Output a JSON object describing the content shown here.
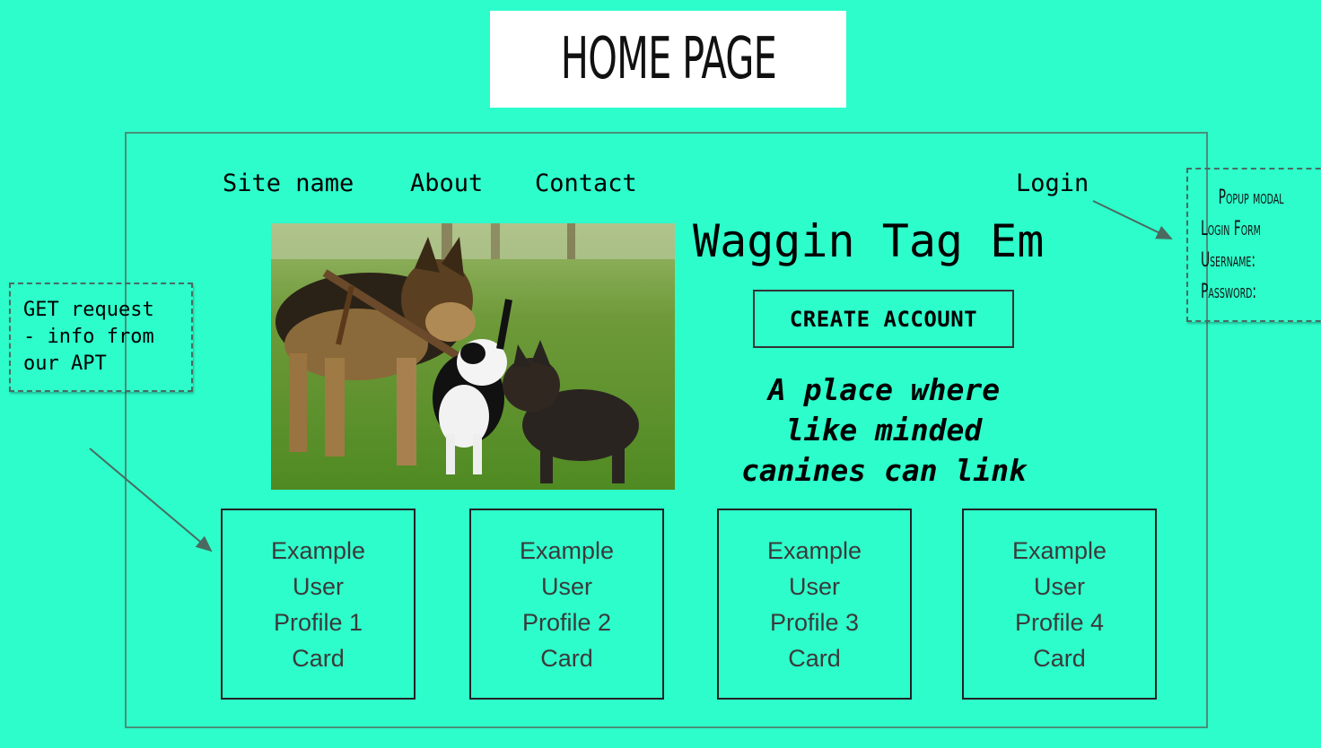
{
  "page_title": "HOME PAGE",
  "nav": {
    "site_name": "Site name",
    "about": "About",
    "contact": "Contact",
    "login": "Login"
  },
  "hero": {
    "site_title": "Waggin Tag Em",
    "create_account": "CREATE ACCOUNT",
    "tagline_lines": [
      "A place where",
      "like minded",
      "canines can link"
    ],
    "image": "three-dogs-playing-photo"
  },
  "cards": [
    {
      "lines": [
        "Example",
        "User",
        "Profile 1",
        "Card"
      ]
    },
    {
      "lines": [
        "Example",
        "User",
        "Profile 2",
        "Card"
      ]
    },
    {
      "lines": [
        "Example",
        "User",
        "Profile 3",
        "Card"
      ]
    },
    {
      "lines": [
        "Example",
        "User",
        "Profile 4",
        "Card"
      ]
    }
  ],
  "annotations": {
    "get_request": [
      "GET request",
      "- info from",
      "our APT"
    ],
    "popup": [
      "Popup modal",
      "Login Form",
      "Username:",
      "Password:"
    ]
  },
  "colors": {
    "background": "#2dfdcb",
    "frame": "#4a8f79"
  }
}
